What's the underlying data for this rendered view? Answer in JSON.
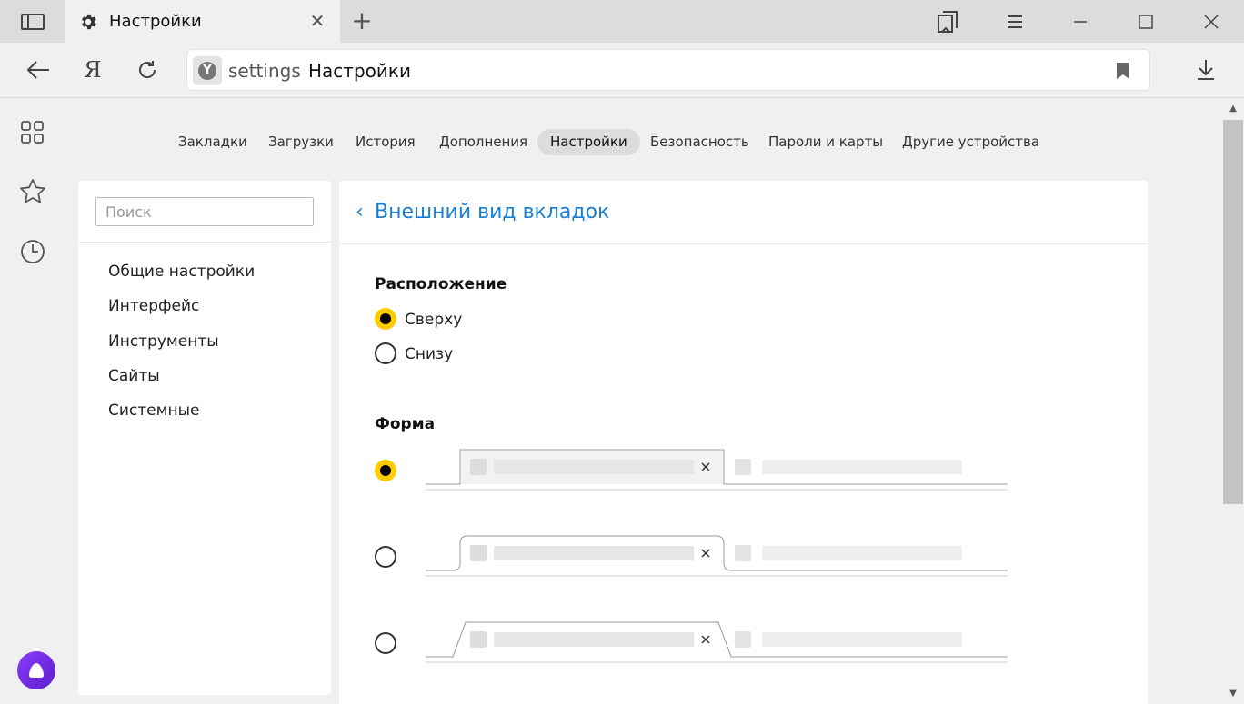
{
  "titlebar": {
    "tab_title": "Настройки",
    "tab_icon": "gear-icon",
    "close_glyph": "✕",
    "new_tab_glyph": "+"
  },
  "addressbar": {
    "host": "settings",
    "page_title": "Настройки",
    "yandex_button": "Я"
  },
  "topnav": {
    "items": [
      {
        "label": "Закладки",
        "active": false
      },
      {
        "label": "Загрузки",
        "active": false
      },
      {
        "label": "История",
        "active": false
      },
      {
        "label": "Дополнения",
        "active": false
      },
      {
        "label": "Настройки",
        "active": true
      },
      {
        "label": "Безопасность",
        "active": false
      },
      {
        "label": "Пароли и карты",
        "active": false
      },
      {
        "label": "Другие устройства",
        "active": false
      }
    ]
  },
  "sidebar": {
    "search_placeholder": "Поиск",
    "items": [
      {
        "label": "Общие настройки"
      },
      {
        "label": "Интерфейс"
      },
      {
        "label": "Инструменты"
      },
      {
        "label": "Сайты"
      },
      {
        "label": "Системные"
      }
    ]
  },
  "main": {
    "back_glyph": "‹",
    "title": "Внешний вид вкладок",
    "position_section": {
      "title": "Расположение",
      "options": [
        {
          "label": "Сверху",
          "checked": true
        },
        {
          "label": "Снизу",
          "checked": false
        }
      ]
    },
    "shape_section": {
      "title": "Форма",
      "options": [
        {
          "shape": "rectangular",
          "checked": true
        },
        {
          "shape": "rounded",
          "checked": false
        },
        {
          "shape": "trapezoid",
          "checked": false
        }
      ]
    },
    "preview_close_glyph": "✕"
  },
  "colors": {
    "accent_link": "#1a7fd1",
    "radio_selected": "#ffcc00",
    "alice": "#7b2ff7"
  }
}
